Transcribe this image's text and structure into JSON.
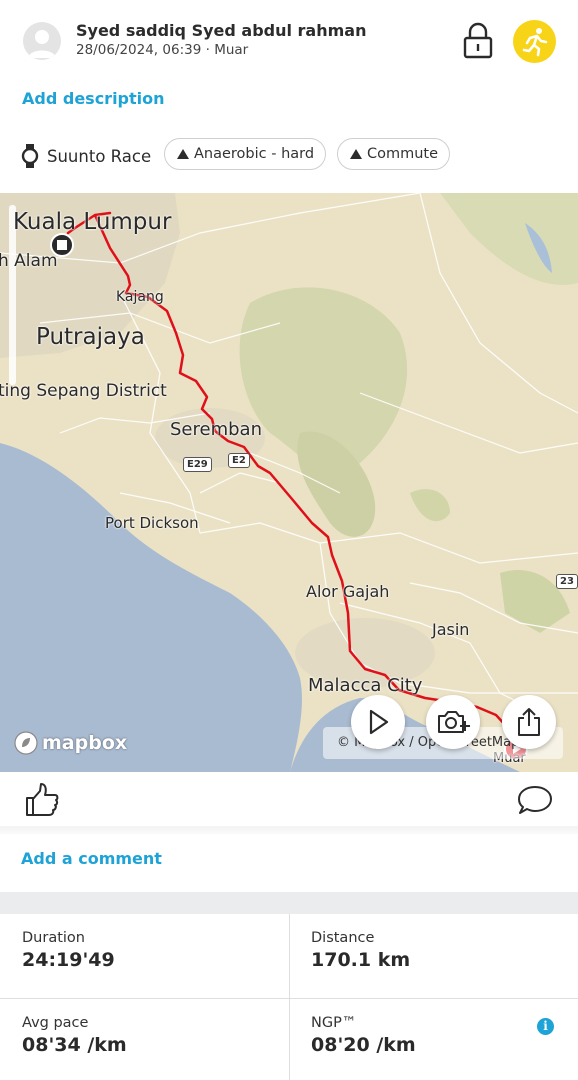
{
  "header": {
    "user_name": "Syed saddiq Syed abdul rahman",
    "date_time": "28/06/2024, 06:39",
    "separator": "·",
    "location": "Muar",
    "sport_badge_color": "#f7d417",
    "icons": [
      "avatar-placeholder",
      "lock-icon",
      "running-icon"
    ]
  },
  "add_description_label": "Add description",
  "tags": {
    "device": "Suunto Race",
    "chips": [
      "Anaerobic - hard",
      "Commute"
    ]
  },
  "map": {
    "places": {
      "kuala_lumpur": "Kuala Lumpur",
      "shah_alam": "h Alam",
      "kajang": "Kajang",
      "putrajaya": "Putrajaya",
      "sepang": "ting  Sepang District",
      "seremban": "Seremban",
      "port_dickson": "Port Dickson",
      "alor_gajah": "Alor Gajah",
      "jasin": "Jasin",
      "malacca": "Malacca City",
      "muar": "Muar"
    },
    "shields": {
      "e29": "E29",
      "e2": "E2",
      "r23": "23"
    },
    "route_color": "#e0101a",
    "logo": "mapbox",
    "attribution": "© Mapbox / OpenStreetMap",
    "buttons": [
      "play-icon",
      "add-photo-icon",
      "share-icon"
    ]
  },
  "add_comment_label": "Add a comment",
  "stats": {
    "duration": {
      "label": "Duration",
      "value": "24:19'49"
    },
    "distance": {
      "label": "Distance",
      "value": "170.1 km"
    },
    "avg_pace": {
      "label": "Avg pace",
      "value": "08'34 /km"
    },
    "ngp": {
      "label": "NGP™",
      "value": "08'20 /km"
    },
    "info_glyph": "i"
  }
}
